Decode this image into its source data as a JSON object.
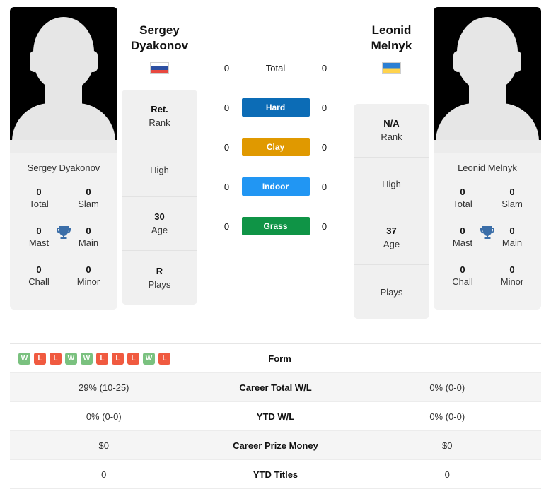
{
  "players": {
    "left": {
      "name_line1": "Sergey",
      "name_line2": "Dyakonov",
      "full_name": "Sergey Dyakonov",
      "flag": "russia-flag",
      "photo": "player-photo-placeholder",
      "info": [
        {
          "value": "Ret.",
          "label": "Rank"
        },
        {
          "value": "",
          "label": "High"
        },
        {
          "value": "30",
          "label": "Age"
        },
        {
          "value": "R",
          "label": "Plays"
        }
      ],
      "titles": [
        {
          "value": "0",
          "label": "Total"
        },
        {
          "value": "0",
          "label": "Slam"
        },
        {
          "value": "0",
          "label": "Mast"
        },
        {
          "value": "0",
          "label": "Main"
        },
        {
          "value": "0",
          "label": "Chall"
        },
        {
          "value": "0",
          "label": "Minor"
        }
      ]
    },
    "right": {
      "name_line1": "Leonid",
      "name_line2": "Melnyk",
      "full_name": "Leonid Melnyk",
      "flag": "ukraine-flag",
      "photo": "player-photo-placeholder",
      "info": [
        {
          "value": "N/A",
          "label": "Rank"
        },
        {
          "value": "",
          "label": "High"
        },
        {
          "value": "37",
          "label": "Age"
        },
        {
          "value": "",
          "label": "Plays"
        }
      ],
      "titles": [
        {
          "value": "0",
          "label": "Total"
        },
        {
          "value": "0",
          "label": "Slam"
        },
        {
          "value": "0",
          "label": "Mast"
        },
        {
          "value": "0",
          "label": "Main"
        },
        {
          "value": "0",
          "label": "Chall"
        },
        {
          "value": "0",
          "label": "Minor"
        }
      ]
    }
  },
  "surfaces": [
    {
      "label": "Total",
      "left": "0",
      "right": "0",
      "color": "",
      "plain": true
    },
    {
      "label": "Hard",
      "left": "0",
      "right": "0",
      "color": "#0c6cb6",
      "plain": false
    },
    {
      "label": "Clay",
      "left": "0",
      "right": "0",
      "color": "#e09900",
      "plain": false
    },
    {
      "label": "Indoor",
      "left": "0",
      "right": "0",
      "color": "#2196f3",
      "plain": false
    },
    {
      "label": "Grass",
      "left": "0",
      "right": "0",
      "color": "#0f9446",
      "plain": false
    }
  ],
  "stats_rows": [
    {
      "label": "Form",
      "left_form": [
        "W",
        "L",
        "L",
        "W",
        "W",
        "L",
        "L",
        "L",
        "W",
        "L"
      ],
      "left": "",
      "right": ""
    },
    {
      "label": "Career Total W/L",
      "left": "29% (10-25)",
      "right": "0% (0-0)"
    },
    {
      "label": "YTD W/L",
      "left": "0% (0-0)",
      "right": "0% (0-0)"
    },
    {
      "label": "Career Prize Money",
      "left": "$0",
      "right": "$0"
    },
    {
      "label": "YTD Titles",
      "left": "0",
      "right": "0"
    }
  ],
  "colors": {
    "win": "#7ac17f",
    "loss": "#f05a40",
    "trophy": "#3b6ea8",
    "hard": "#0c6cb6",
    "clay": "#e09900",
    "indoor": "#2196f3",
    "grass": "#0f9446"
  }
}
